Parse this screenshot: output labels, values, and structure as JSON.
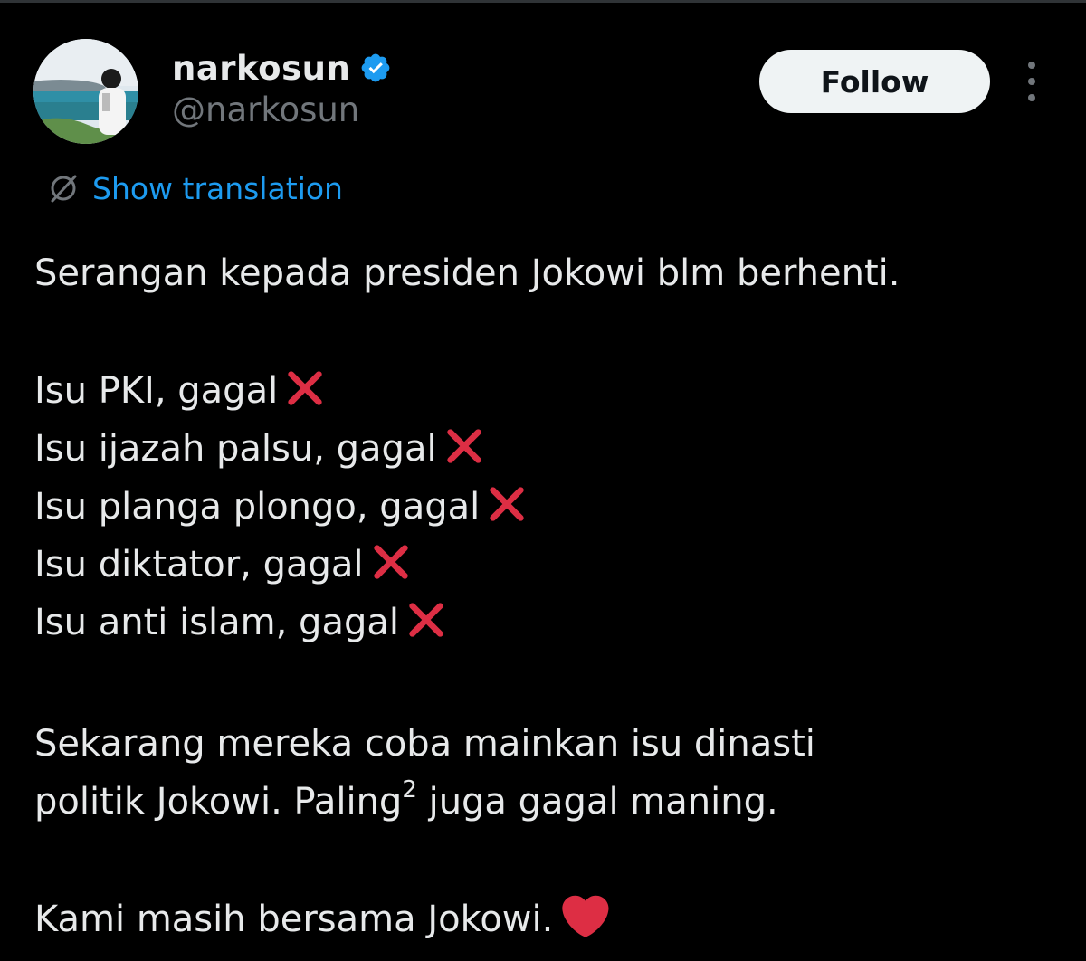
{
  "author": {
    "display_name": "narkosun",
    "handle": "@narkosun",
    "verified": true
  },
  "actions": {
    "follow_label": "Follow",
    "more_icon": "more-vertical-icon"
  },
  "translation": {
    "label": "Show translation"
  },
  "tweet": {
    "line1": "Serangan kepada presiden Jokowi blm berhenti.",
    "issues": [
      "Isu PKI, gagal",
      "Isu ijazah palsu, gagal",
      "Isu planga plongo, gagal",
      "Isu diktator, gagal",
      "Isu anti islam, gagal"
    ],
    "para2_line1": "Sekarang mereka coba mainkan isu dinasti",
    "para2_line2_a": "politik Jokowi. Paling",
    "para2_line2_sup": "2",
    "para2_line2_b": " juga gagal maning.",
    "closing": "Kami masih bersama Jokowi."
  },
  "colors": {
    "background": "#000000",
    "text": "#e7e9ea",
    "secondary": "#71767b",
    "link": "#1d9bf0",
    "verified": "#1d9bf0",
    "cross": "#dd2e44",
    "heart": "#dd2e44"
  }
}
